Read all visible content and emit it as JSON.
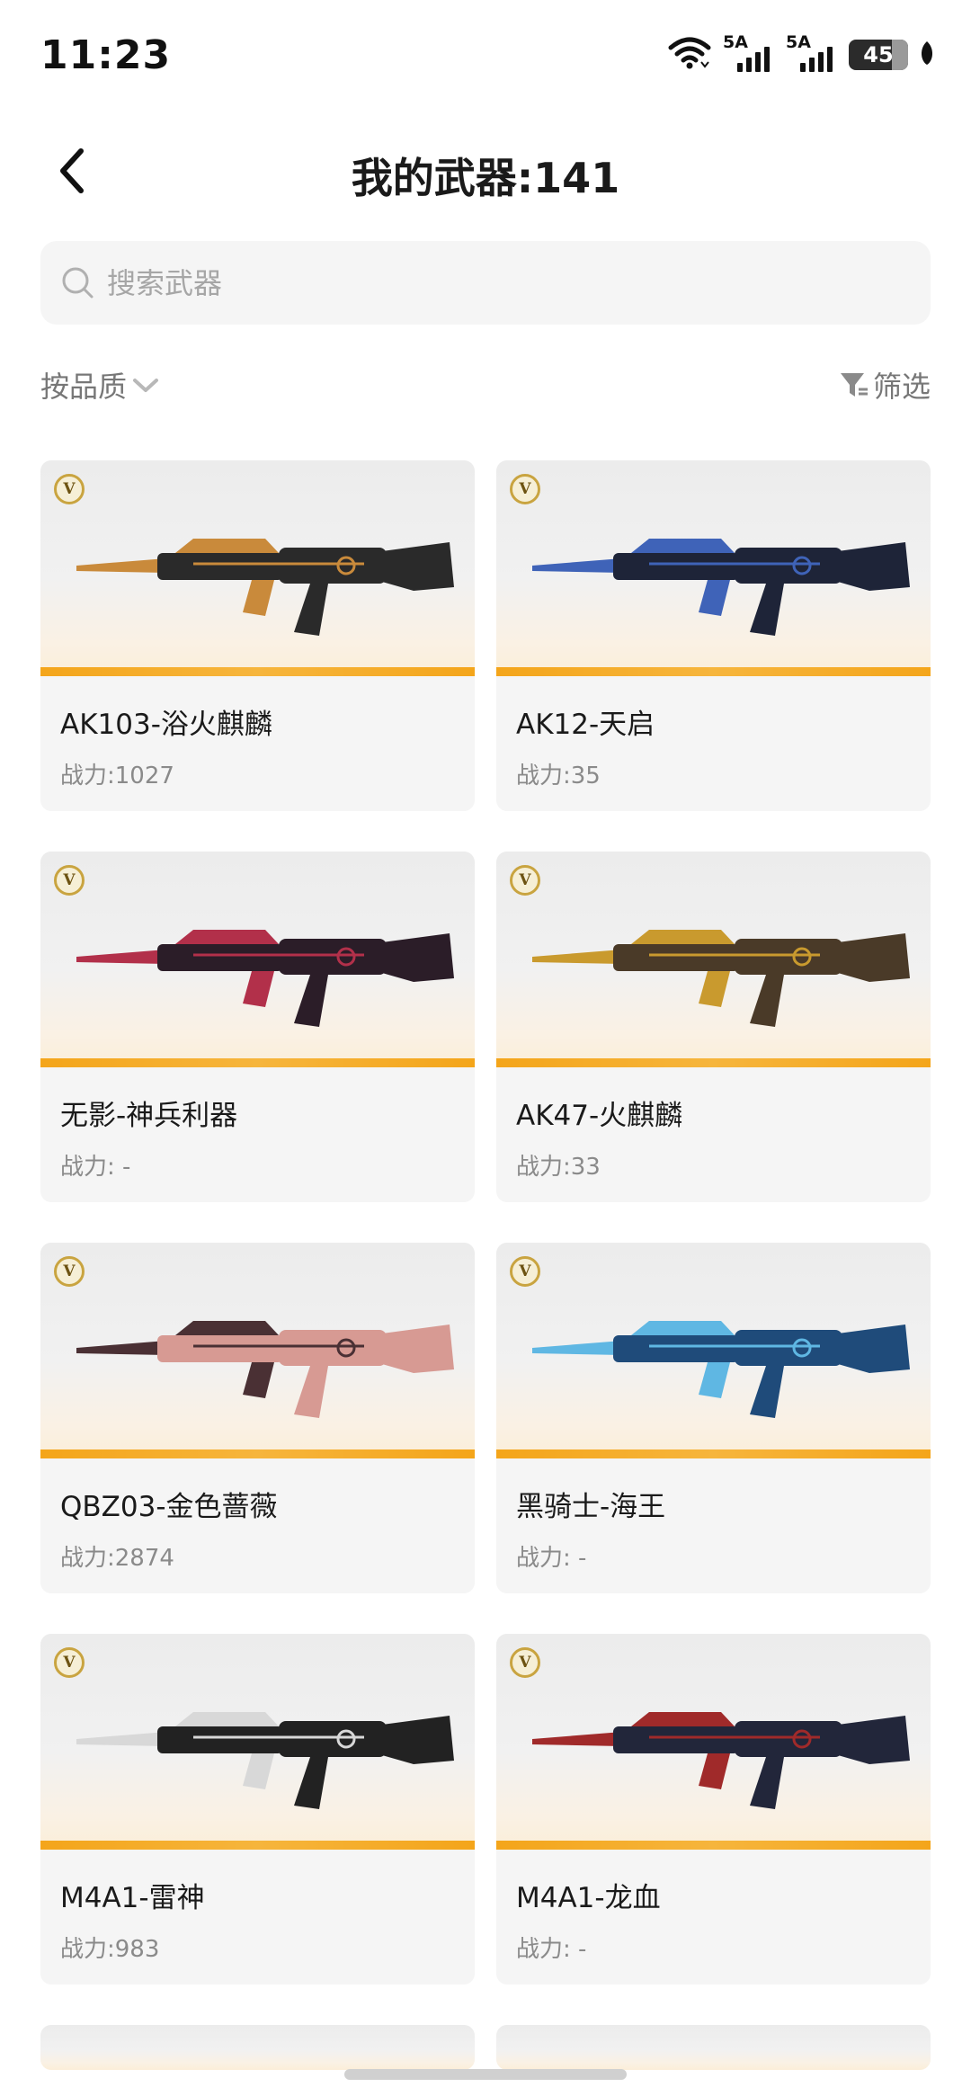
{
  "status_bar": {
    "time": "11:23",
    "signal1_label": "5A",
    "signal2_label": "5A",
    "battery": "45"
  },
  "header": {
    "title": "我的武器:141"
  },
  "search": {
    "placeholder": "搜索武器"
  },
  "sort": {
    "label": "按品质",
    "filter_label": "筛选"
  },
  "weapons": [
    {
      "name": "AK103-浴火麒麟",
      "power": "战力:1027",
      "badge": "V",
      "colors": [
        "#2a2a2a",
        "#c98a3b"
      ]
    },
    {
      "name": "AK12-天启",
      "power": "战力:35",
      "badge": "V",
      "colors": [
        "#1e2438",
        "#3f63b8"
      ]
    },
    {
      "name": "无影-神兵利器",
      "power": "战力: -",
      "badge": "V",
      "colors": [
        "#2b1d28",
        "#b2304a"
      ]
    },
    {
      "name": "AK47-火麒麟",
      "power": "战力:33",
      "badge": "V",
      "colors": [
        "#4a3a28",
        "#c99a2e"
      ]
    },
    {
      "name": "QBZ03-金色蔷薇",
      "power": "战力:2874",
      "badge": "V",
      "colors": [
        "#d79a93",
        "#4a3034"
      ]
    },
    {
      "name": "黑骑士-海王",
      "power": "战力: -",
      "badge": "V",
      "colors": [
        "#1f4b7a",
        "#5fb7e3"
      ]
    },
    {
      "name": "M4A1-雷神",
      "power": "战力:983",
      "badge": "V",
      "colors": [
        "#222222",
        "#d8d8d8"
      ]
    },
    {
      "name": "M4A1-龙血",
      "power": "战力: -",
      "badge": "V",
      "colors": [
        "#22263a",
        "#a02a2a"
      ]
    }
  ]
}
